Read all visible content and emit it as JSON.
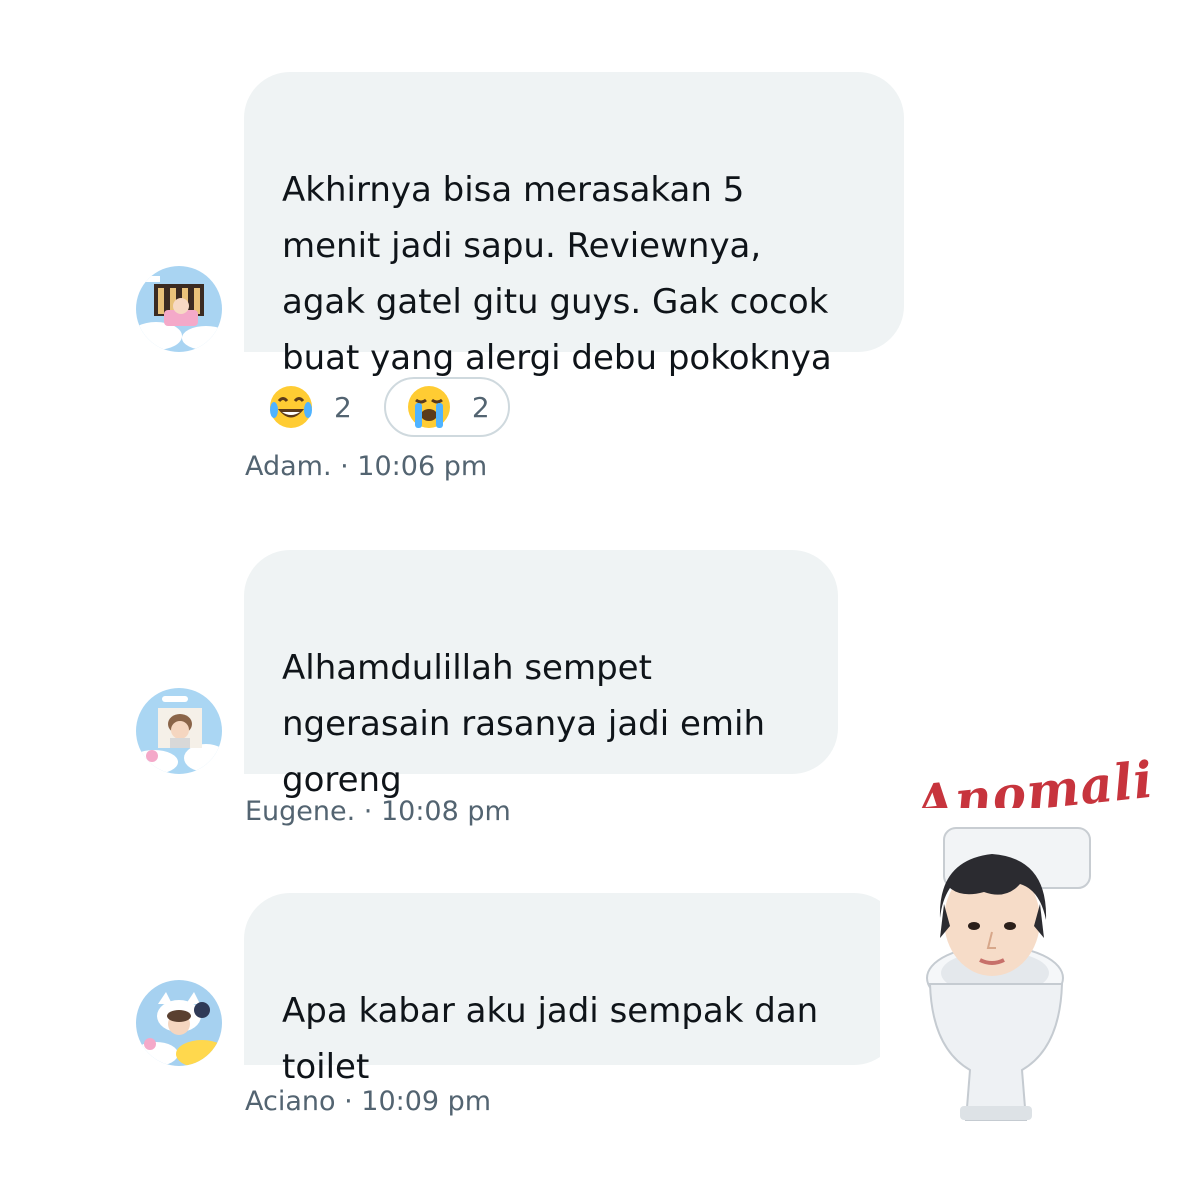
{
  "messages": [
    {
      "text": "Akhirnya bisa merasakan 5\nmenit jadi sapu. Reviewnya,\nagak gatel gitu guys. Gak cocok\nbuat yang alergi debu pokoknya",
      "author": "Adam.",
      "time": "10:06 pm",
      "meta": "Adam. · 10:06 pm",
      "reactions": [
        {
          "emoji": "face-with-tears-of-joy-icon",
          "count": "2",
          "selected": false
        },
        {
          "emoji": "loudly-crying-face-icon",
          "count": "2",
          "selected": true
        }
      ]
    },
    {
      "text": "Alhamdulillah sempet\nngerasain rasanya jadi emih\ngoreng",
      "author": "Eugene.",
      "time": "10:08 pm",
      "meta": "Eugene. · 10:08 pm"
    },
    {
      "text": "Apa kabar aku jadi sempak dan\ntoilet",
      "author": "Aciano",
      "time": "10:09 pm",
      "meta": "Aciano · 10:09 pm"
    }
  ],
  "sticker": {
    "title": "Anomali",
    "icon": "person-in-toilet-sticker"
  },
  "colors": {
    "bubble": "#eff3f4",
    "text": "#0f1419",
    "meta": "#536471",
    "sticker_title": "#c7343d"
  }
}
